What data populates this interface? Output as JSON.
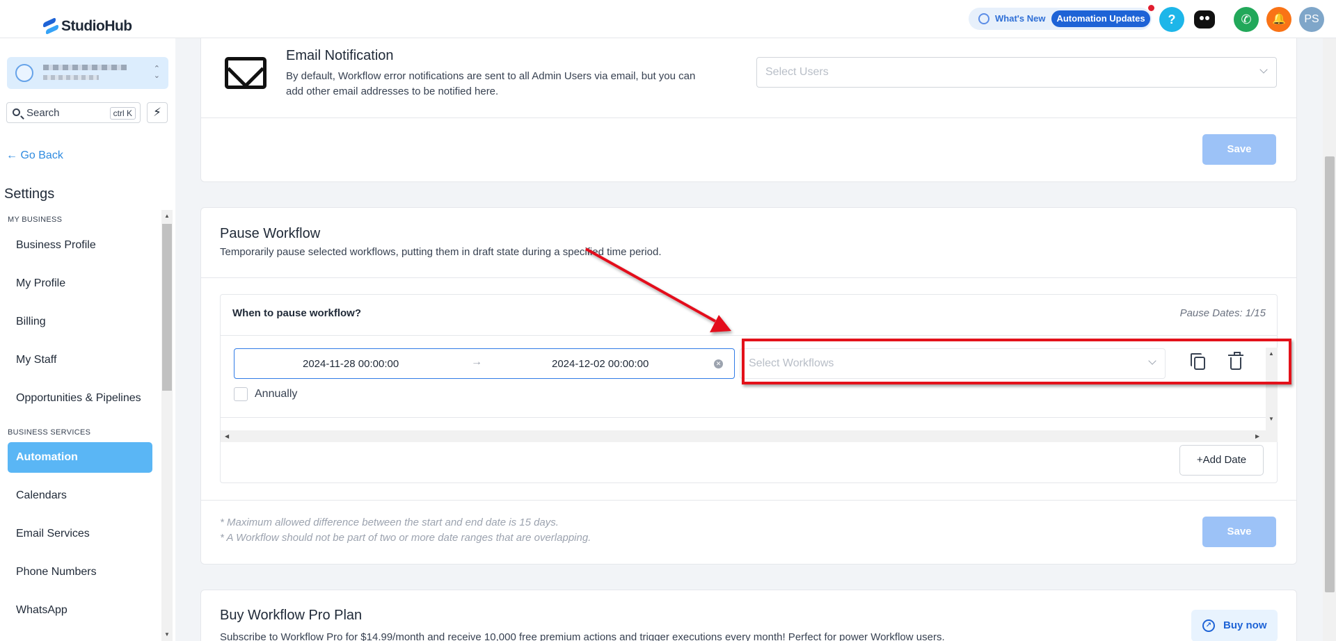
{
  "app": {
    "name": "StudioHub"
  },
  "header": {
    "whats_new": "What's New",
    "automation_updates": "Automation Updates",
    "help": "?",
    "avatar_initials": "PS"
  },
  "sidebar": {
    "search_label": "Search",
    "search_shortcut": "ctrl K",
    "go_back": "Go Back",
    "settings_title": "Settings",
    "section_my_business": "MY BUSINESS",
    "section_business_services": "BUSINESS SERVICES",
    "items": [
      {
        "label": "Business Profile"
      },
      {
        "label": "My Profile"
      },
      {
        "label": "Billing"
      },
      {
        "label": "My Staff"
      },
      {
        "label": "Opportunities & Pipelines"
      },
      {
        "label": "Automation"
      },
      {
        "label": "Calendars"
      },
      {
        "label": "Email Services"
      },
      {
        "label": "Phone Numbers"
      },
      {
        "label": "WhatsApp"
      }
    ]
  },
  "email_notification": {
    "title": "Email Notification",
    "description_line1": "By default, Workflow error notifications are sent to all Admin Users via email, but you can",
    "description_line2": "add other email addresses to be notified here.",
    "select_placeholder": "Select Users",
    "save_label": "Save"
  },
  "pause_workflow": {
    "title": "Pause Workflow",
    "description": "Temporarily pause selected workflows, putting them in draft state during a specified time period.",
    "question": "When to pause workflow?",
    "pause_dates": "Pause Dates: 1/15",
    "start_date": "2024-11-28 00:00:00",
    "end_date": "2024-12-02 00:00:00",
    "annually_label": "Annually",
    "select_workflows_placeholder": "Select Workflows",
    "add_date_label": "Add Date",
    "note1": "* Maximum allowed difference between the start and end date is 15 days.",
    "note2": "* A Workflow should not be part of two or more date ranges that are overlapping.",
    "save_label": "Save"
  },
  "pro_plan": {
    "title": "Buy Workflow Pro Plan",
    "description": "Subscribe to Workflow Pro for $14.99/month and receive 10,000 free premium actions and trigger executions every month! Perfect for power Workflow users.",
    "buy_label": "Buy now"
  },
  "colors": {
    "accent": "#1e63d6",
    "active_nav": "#5ab6f5",
    "save_disabled": "#9cc2f7",
    "annotation": "#e3111a"
  }
}
